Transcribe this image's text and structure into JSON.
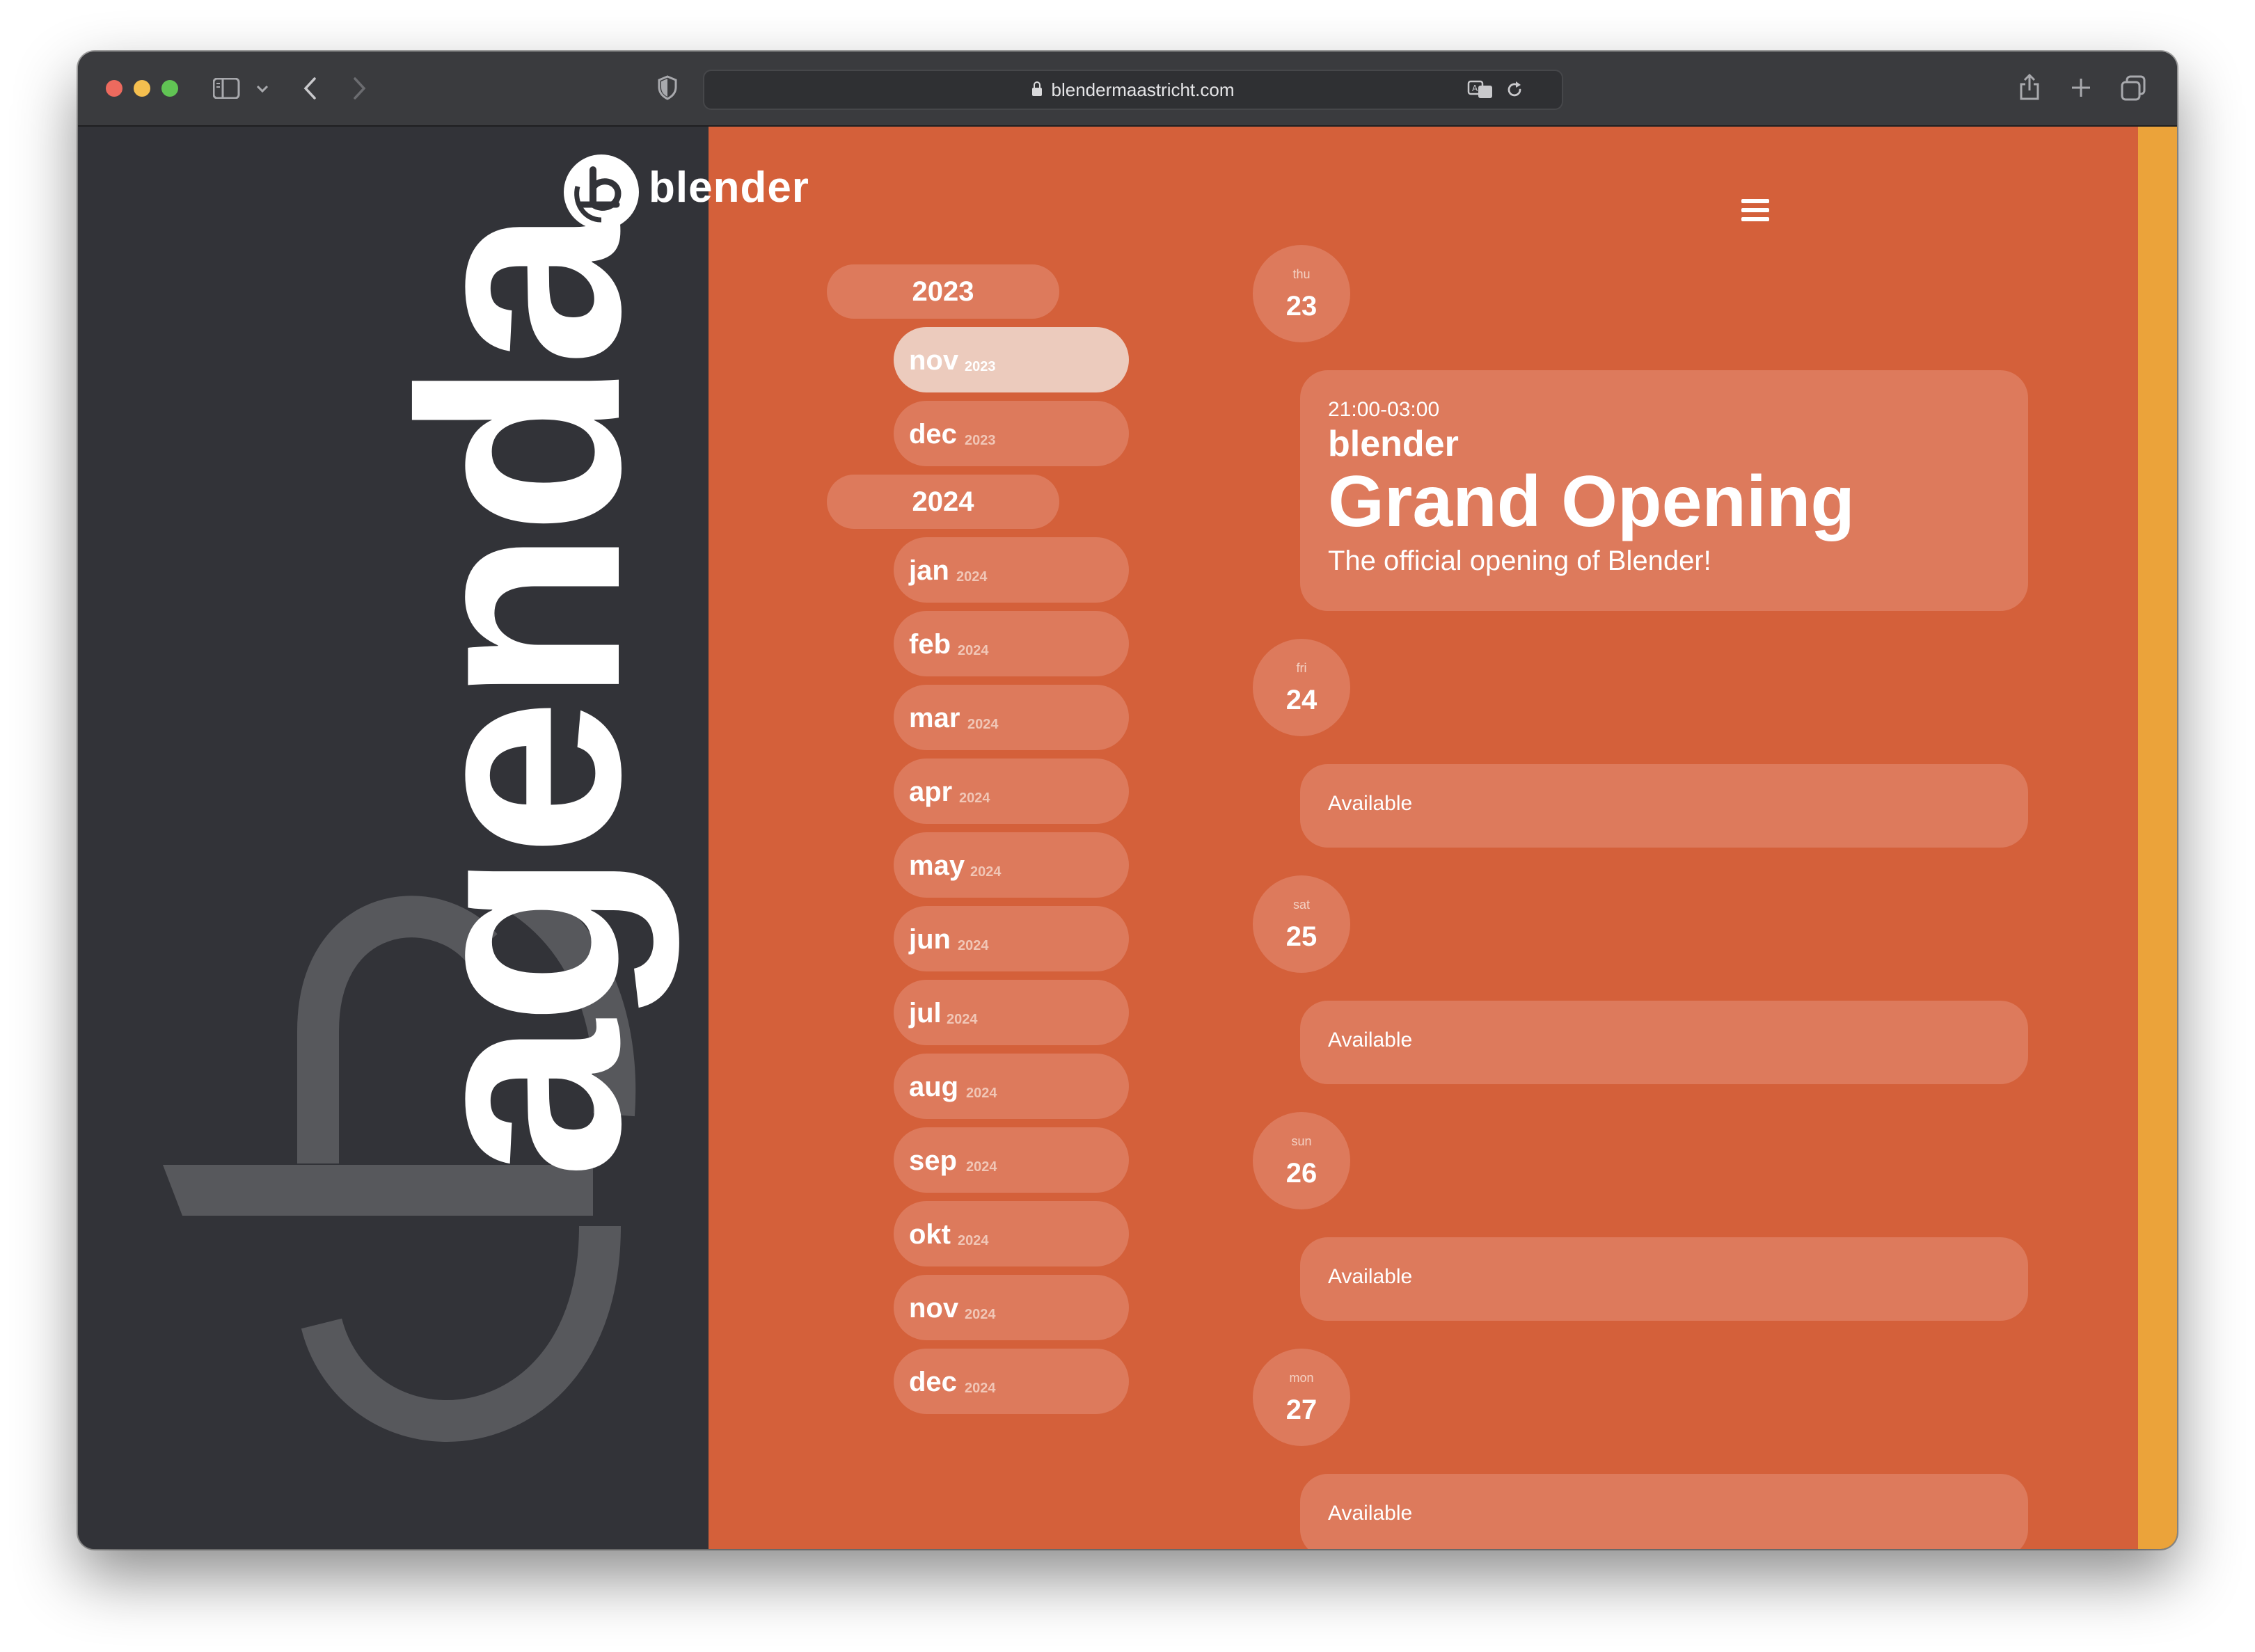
{
  "browser": {
    "url": "blendermaastricht.com"
  },
  "site": {
    "logo_text": "blender",
    "side_title": "agenda"
  },
  "months_nav": [
    {
      "type": "year",
      "label": "2023"
    },
    {
      "type": "month",
      "label": "nov",
      "year": "2023",
      "active": true
    },
    {
      "type": "month",
      "label": "dec",
      "year": "2023"
    },
    {
      "type": "year",
      "label": "2024"
    },
    {
      "type": "month",
      "label": "jan",
      "year": "2024"
    },
    {
      "type": "month",
      "label": "feb",
      "year": "2024"
    },
    {
      "type": "month",
      "label": "mar",
      "year": "2024"
    },
    {
      "type": "month",
      "label": "apr",
      "year": "2024"
    },
    {
      "type": "month",
      "label": "may",
      "year": "2024"
    },
    {
      "type": "month",
      "label": "jun",
      "year": "2024"
    },
    {
      "type": "month",
      "label": "jul",
      "year": "2024"
    },
    {
      "type": "month",
      "label": "aug",
      "year": "2024"
    },
    {
      "type": "month",
      "label": "sep",
      "year": "2024"
    },
    {
      "type": "month",
      "label": "okt",
      "year": "2024"
    },
    {
      "type": "month",
      "label": "nov",
      "year": "2024"
    },
    {
      "type": "month",
      "label": "dec",
      "year": "2024"
    }
  ],
  "days": [
    {
      "dow": "thu",
      "day": "23"
    },
    {
      "dow": "fri",
      "day": "24"
    },
    {
      "dow": "sat",
      "day": "25"
    },
    {
      "dow": "sun",
      "day": "26"
    },
    {
      "dow": "mon",
      "day": "27"
    }
  ],
  "event": {
    "time": "21:00-03:00",
    "venue": "blender",
    "title": "Grand Opening",
    "description": "The official opening of Blender!"
  },
  "available_label": "Available",
  "colors": {
    "left_panel": "#323338",
    "main_panel": "#d4603a",
    "pill": "#dd7a5c",
    "active_pill": "#eccbbd",
    "right_strip": "#eba33a"
  },
  "icons": {
    "hamburger": "menu-icon",
    "logo": "blender-logo-icon"
  }
}
